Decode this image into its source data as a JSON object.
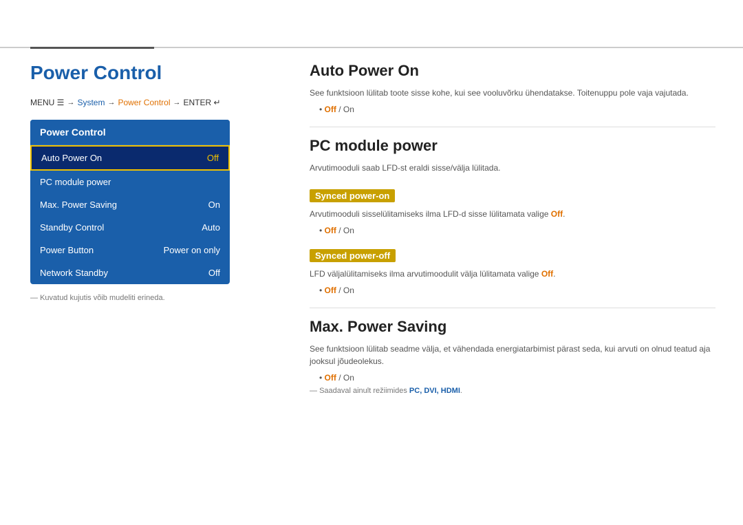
{
  "page": {
    "title": "Power Control",
    "top_divider": true
  },
  "breadcrumb": {
    "menu": "MENU ☰",
    "arrow1": "→",
    "system": "System",
    "arrow2": "→",
    "power_control": "Power Control",
    "arrow3": "→",
    "enter": "ENTER ↵"
  },
  "menu": {
    "header": "Power Control",
    "items": [
      {
        "label": "Auto Power On",
        "value": "Off",
        "selected": true
      },
      {
        "label": "PC module power",
        "value": "",
        "selected": false
      },
      {
        "label": "Max. Power Saving",
        "value": "On",
        "selected": false
      },
      {
        "label": "Standby Control",
        "value": "Auto",
        "selected": false
      },
      {
        "label": "Power Button",
        "value": "Power on only",
        "selected": false
      },
      {
        "label": "Network Standby",
        "value": "Off",
        "selected": false
      }
    ],
    "footnote": "Kuvatud kujutis võib mudeliti erineda."
  },
  "content": {
    "auto_power_on": {
      "title": "Auto Power On",
      "desc": "See funktsioon lülitab toote sisse kohe, kui see vooluvõrku ühendatakse. Toitenuppu pole vaja vajutada.",
      "options": "Off / On"
    },
    "pc_module_power": {
      "title": "PC module power",
      "desc": "Arvutimooduli saab LFD-st eraldi sisse/välja lülitada.",
      "synced_on": {
        "label": "Synced power-on",
        "desc": "Arvutimooduli sisselülitamiseks ilma LFD-d sisse lülitamata valige",
        "highlight": "Off",
        "options": "Off / On"
      },
      "synced_off": {
        "label": "Synced power-off",
        "desc": "LFD väljalülitamiseks ilma arvutimoodulit välja lülitamata valige",
        "highlight": "Off",
        "options": "Off / On"
      }
    },
    "max_power_saving": {
      "title": "Max. Power Saving",
      "desc": "See funktsioon lülitab seadme välja, et vähendada energiatarbimist pärast seda, kui arvuti on olnud teatud aja jooksul jõudeolekus.",
      "options": "Off / On",
      "note_prefix": "Saadaval ainult režiimides ",
      "note_modes": "PC, DVI, HDMI"
    }
  }
}
